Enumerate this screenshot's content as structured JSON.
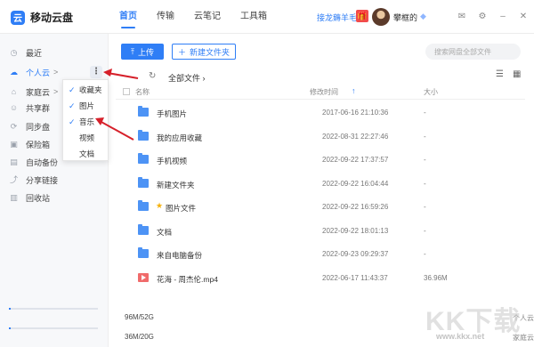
{
  "app": {
    "logo_glyph": "云",
    "name": "移动云盘"
  },
  "nav": [
    {
      "label": "首页",
      "active": true
    },
    {
      "label": "传输",
      "active": false
    },
    {
      "label": "云笔记",
      "active": false
    },
    {
      "label": "工具箱",
      "active": false
    }
  ],
  "header": {
    "promo": "接龙薅羊毛",
    "username": "攀框的"
  },
  "sidebar": {
    "items": [
      {
        "label": "最近",
        "icon": "clock-icon"
      },
      {
        "label": "个人云",
        "icon": "cloud-icon"
      },
      {
        "label": "家庭云",
        "icon": "home-icon"
      },
      {
        "label": "共享群",
        "icon": "group-icon"
      },
      {
        "label": "同步盘",
        "icon": "sync-icon"
      },
      {
        "label": "保险箱",
        "icon": "safe-icon"
      },
      {
        "label": "自动备份",
        "icon": "backup-icon"
      },
      {
        "label": "分享链接",
        "icon": "share-icon"
      },
      {
        "label": "回收站",
        "icon": "trash-icon"
      }
    ],
    "caret": ">",
    "quotas": [
      {
        "used": "96M/52G",
        "label": "个人云",
        "fraction": 0.02
      },
      {
        "used": "36M/20G",
        "label": "家庭云",
        "fraction": 0.02
      }
    ]
  },
  "menu": {
    "items": [
      {
        "label": "收藏夹",
        "checked": true
      },
      {
        "label": "图片",
        "checked": true
      },
      {
        "label": "音乐",
        "checked": true
      },
      {
        "label": "视频",
        "checked": false
      },
      {
        "label": "文档",
        "checked": false
      }
    ]
  },
  "toolbar": {
    "upload_label": "上传",
    "new_folder_label": "新建文件夹",
    "search_placeholder": "搜索网盘全部文件"
  },
  "breadcrumb": "全部文件",
  "table": {
    "headers": {
      "name": "名称",
      "date": "修改时间",
      "size": "大小"
    },
    "rows": [
      {
        "name": "手机图片",
        "date": "2017-06-16 21:10:36",
        "size": "-",
        "type": "folder",
        "starred": false
      },
      {
        "name": "我的应用收藏",
        "date": "2022-08-31 22:27:46",
        "size": "-",
        "type": "folder",
        "starred": false
      },
      {
        "name": "手机视频",
        "date": "2022-09-22 17:37:57",
        "size": "-",
        "type": "folder",
        "starred": false
      },
      {
        "name": "新建文件夹",
        "date": "2022-09-22 16:04:44",
        "size": "-",
        "type": "folder",
        "starred": false
      },
      {
        "name": "图片文件",
        "date": "2022-09-22 16:59:26",
        "size": "-",
        "type": "folder",
        "starred": true
      },
      {
        "name": "文档",
        "date": "2022-09-22 18:01:13",
        "size": "-",
        "type": "folder",
        "starred": false
      },
      {
        "name": "来自电脑备份",
        "date": "2022-09-23 09:29:37",
        "size": "-",
        "type": "folder",
        "starred": false
      },
      {
        "name": "花海 - 周杰伦.mp4",
        "date": "2022-06-17 11:43:37",
        "size": "36.96M",
        "type": "video",
        "starred": false
      }
    ]
  },
  "watermark": {
    "text": "KK下载",
    "url": "www.kkx.net"
  },
  "colors": {
    "accent": "#2f7ef6",
    "arrow": "#d6202a",
    "star": "#f5b10a"
  }
}
